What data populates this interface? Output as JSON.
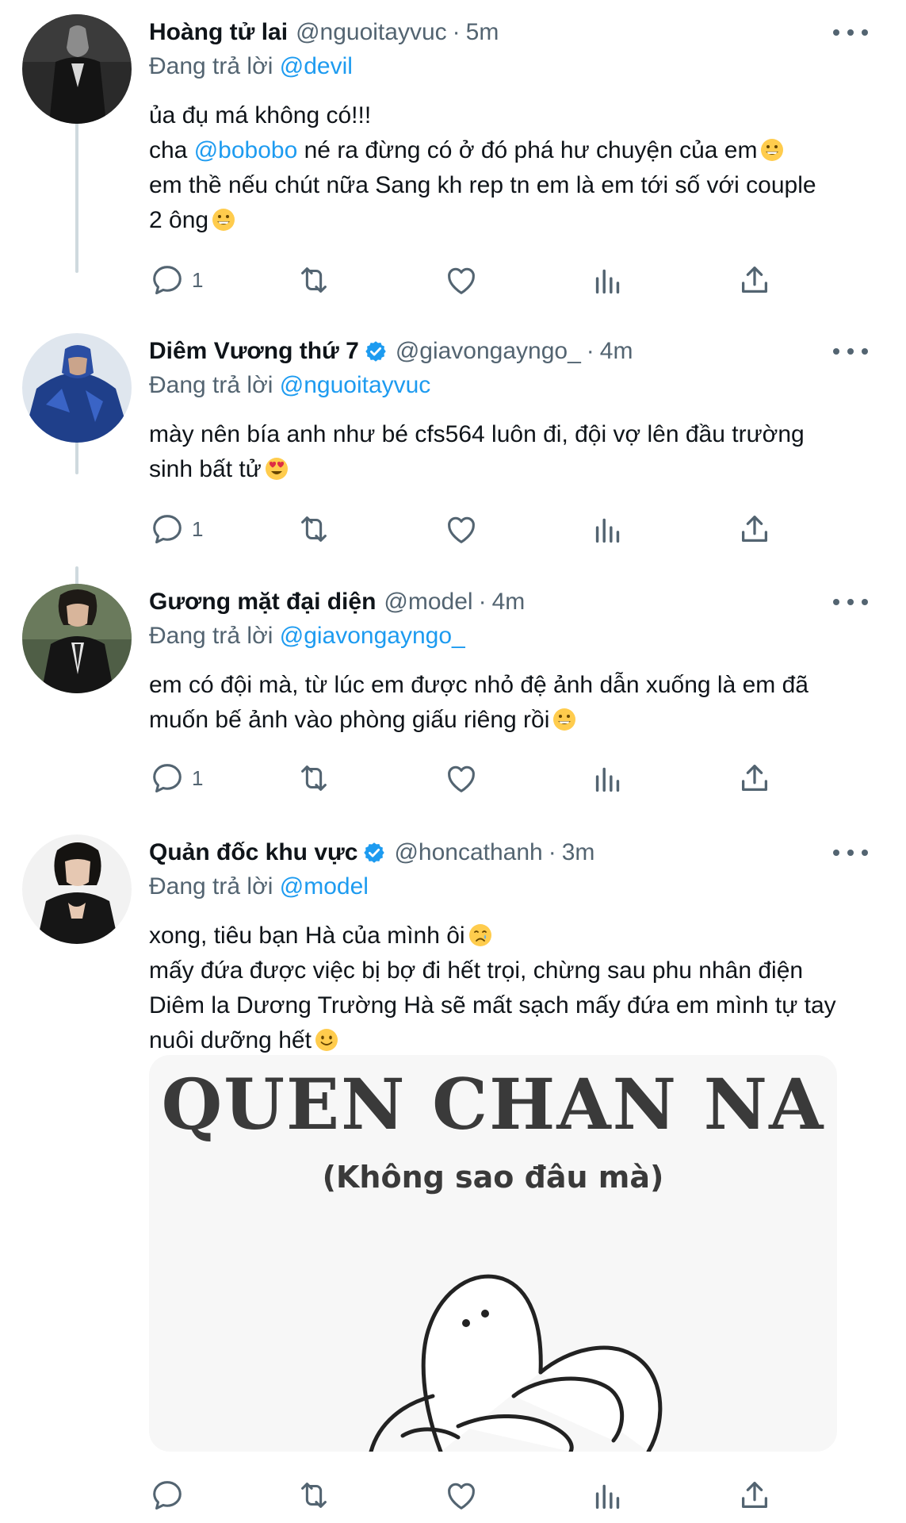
{
  "tweets": [
    {
      "name": "Hoàng tử lai",
      "verified": false,
      "handle": "@nguoitayvuc",
      "time": "5m",
      "reply_prefix": "Đang trả lời",
      "reply_to": "@devil",
      "lines": [
        "ủa đụ má không có!!!",
        {
          "pre": "cha ",
          "mention": "@bobobo",
          "post": " né ra đừng có ở đó phá hư chuyện của em"
        },
        "em thề nếu chút nữa Sang kh rep tn em là em tới số với couple",
        "2 ông"
      ],
      "reply_count": "1"
    },
    {
      "name": "Diêm Vương thứ 7",
      "verified": true,
      "handle": "@giavongayngo_",
      "time": "4m",
      "reply_prefix": "Đang trả lời",
      "reply_to": "@nguoitayvuc",
      "lines": [
        "mày nên bía anh như bé cfs564 luôn đi, đội vợ lên đầu trường",
        "sinh bất tử"
      ],
      "reply_count": "1"
    },
    {
      "name": "Gương mặt đại diện",
      "verified": false,
      "handle": "@model",
      "time": "4m",
      "reply_prefix": "Đang trả lời",
      "reply_to": "@giavongayngo_",
      "lines": [
        "em có đội mà, từ lúc em được nhỏ đệ ảnh dẫn xuống là em đã",
        "muốn bế ảnh vào phòng giấu riêng rồi"
      ],
      "reply_count": "1"
    },
    {
      "name": "Quản đốc khu vực",
      "verified": true,
      "handle": "@honcathanh",
      "time": "3m",
      "reply_prefix": "Đang trả lời",
      "reply_to": "@model",
      "lines": [
        "xong, tiêu bạn Hà của mình ôi",
        "mấy đứa được việc bị bợ đi hết trọi, chừng sau phu nhân điện",
        "Diêm la Dương Trường Hà sẽ mất sạch mấy đứa em mình tự tay",
        "nuôi dưỡng hết"
      ],
      "reply_count": "",
      "media": {
        "title": "QUEN CHAN NA",
        "subtitle": "(Không sao đâu mà)"
      }
    }
  ],
  "icons": {
    "reply": "reply-icon",
    "retweet": "retweet-icon",
    "like": "like-icon",
    "views": "views-icon",
    "share": "share-icon",
    "more": "more-icon",
    "verified": "verified-badge-icon"
  },
  "colors": {
    "text": "#0f1419",
    "secondary": "#536471",
    "accent": "#1d9bf0",
    "thread_line": "#cfd9de"
  }
}
